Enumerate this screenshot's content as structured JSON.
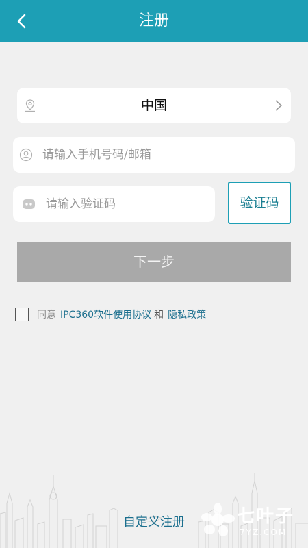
{
  "header": {
    "title": "注册"
  },
  "form": {
    "country": "中国",
    "phone_placeholder": "请输入手机号码/邮箱",
    "code_placeholder": "请输入验证码",
    "get_code_label": "验证码",
    "next_label": "下一步"
  },
  "agreement": {
    "prefix": "同意",
    "terms_link": "IPC360软件使用协议",
    "conjunction": "和",
    "privacy_link": "隐私政策"
  },
  "footer": {
    "custom_register_label": "自定义注册"
  },
  "watermark": {
    "brand": "七叶子",
    "site": "7YZ.COM"
  },
  "colors": {
    "accent": "#1d9fb5",
    "disabled_button": "#a9a9a9",
    "link": "#1b6f8e"
  },
  "icons": {
    "back": "chevron-left-icon",
    "country": "location-pin-icon",
    "country_arrow": "chevron-right-icon",
    "phone": "user-icon",
    "code": "message-icon"
  }
}
